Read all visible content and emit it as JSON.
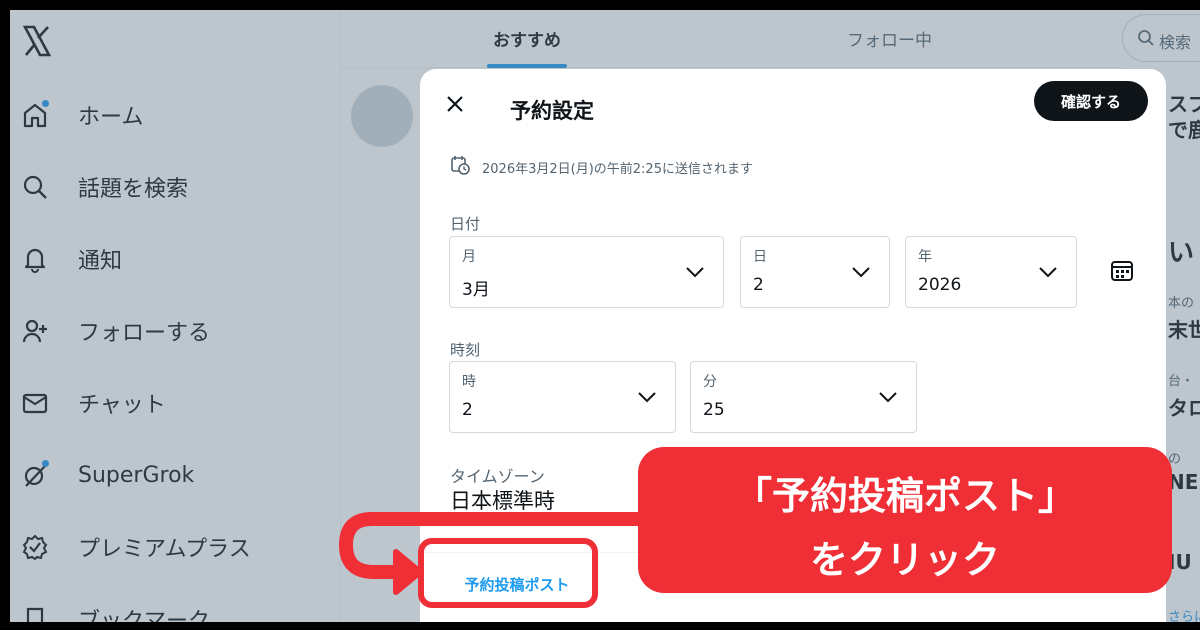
{
  "sidebar": {
    "logo": "X",
    "items": [
      {
        "label": "ホーム",
        "icon": "home-icon"
      },
      {
        "label": "話題を検索",
        "icon": "search-icon"
      },
      {
        "label": "通知",
        "icon": "bell-icon"
      },
      {
        "label": "フォローする",
        "icon": "follow-icon"
      },
      {
        "label": "チャット",
        "icon": "mail-icon"
      },
      {
        "label": "SuperGrok",
        "icon": "grok-icon"
      },
      {
        "label": "プレミアムプラス",
        "icon": "verified-icon"
      },
      {
        "label": "ブックマーク",
        "icon": "bookmark-icon"
      }
    ]
  },
  "timeline": {
    "tabs": [
      "おすすめ",
      "フォロー中"
    ]
  },
  "right": {
    "search_placeholder": "検索",
    "snippets": [
      "スプ",
      "で鹿",
      "い",
      "本の",
      "末世",
      "台・",
      "タロ",
      "の",
      "NE",
      "IU",
      "さらに"
    ]
  },
  "modal": {
    "title": "予約設定",
    "confirm_label": "確認する",
    "schedule_note": "2026年3月2日(月)の午前2:25に送信されます",
    "date_section": "日付",
    "date_fields": {
      "month": {
        "label": "月",
        "value": "3月"
      },
      "day": {
        "label": "日",
        "value": "2"
      },
      "year": {
        "label": "年",
        "value": "2026"
      }
    },
    "time_section": "時刻",
    "time_fields": {
      "hour": {
        "label": "時",
        "value": "2"
      },
      "minute": {
        "label": "分",
        "value": "25"
      }
    },
    "timezone_label": "タイムゾーン",
    "timezone_value": "日本標準時",
    "scheduled_posts_label": "予約投稿ポスト"
  },
  "annotation": {
    "line1": "「予約投稿ポスト」",
    "line2": "をクリック",
    "color": "#ef2e36"
  },
  "colors": {
    "accent": "#1d9bf0",
    "text": "#0f1419",
    "muted": "#536471"
  }
}
